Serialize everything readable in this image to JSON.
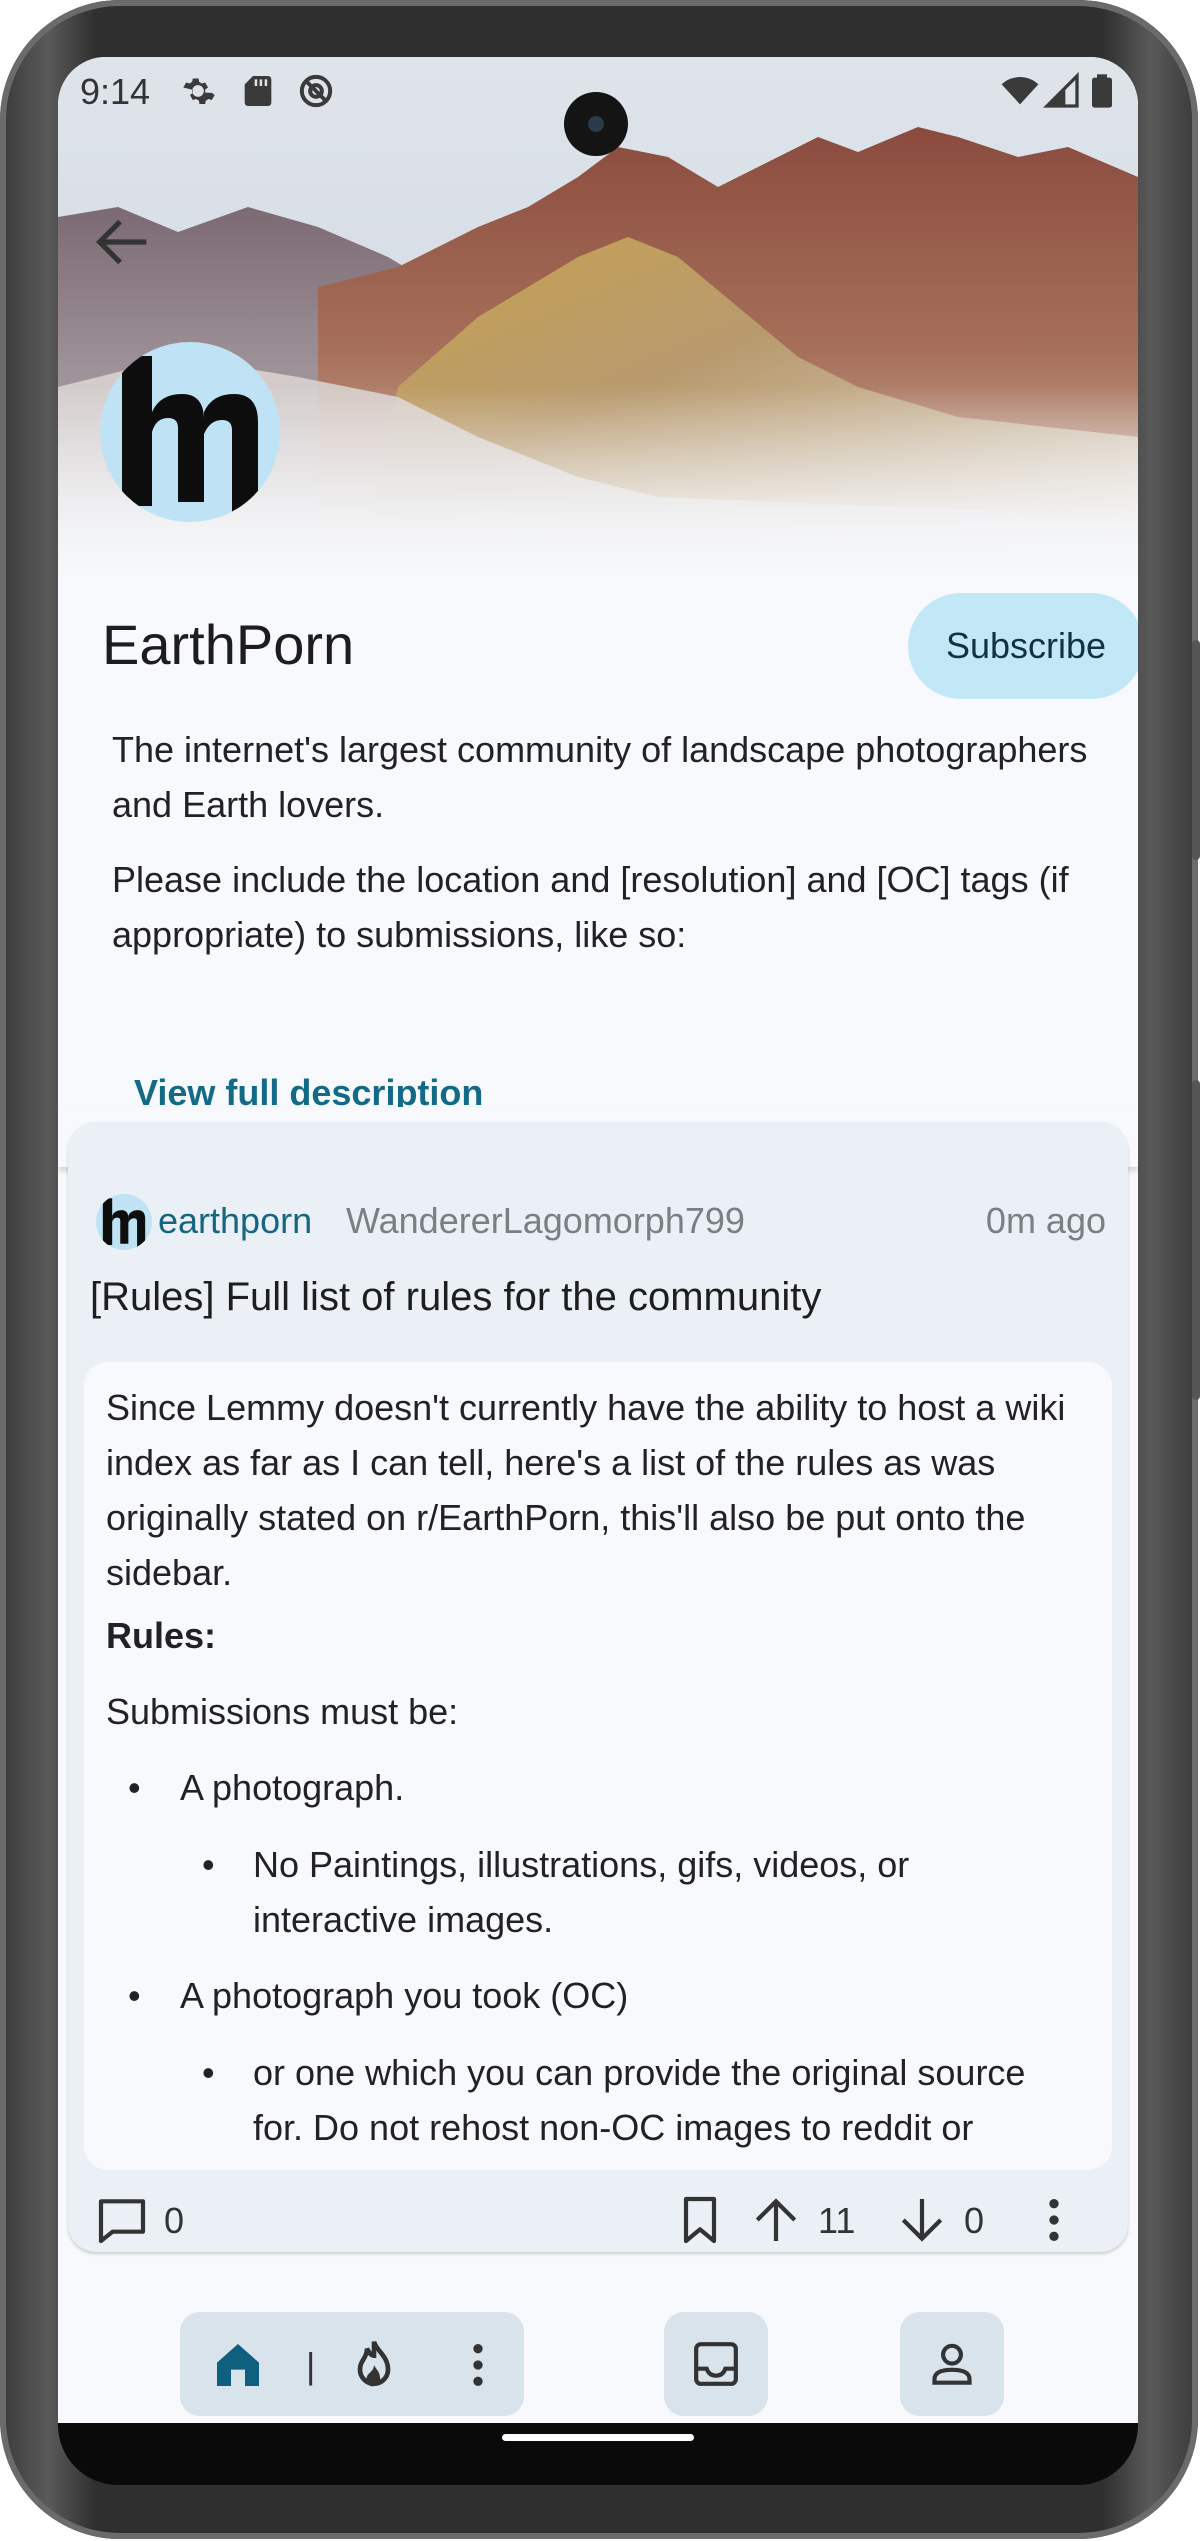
{
  "status_bar": {
    "time": "9:14"
  },
  "community": {
    "name": "EarthPorn",
    "subscribe_label": "Subscribe",
    "description_1": "The internet's largest community of landscape photographers and Earth lovers.",
    "description_2": "Please include the location and [resolution] and [OC] tags (if appropriate) to submissions, like so:",
    "view_full_label": "View full description"
  },
  "post": {
    "community": "earthporn",
    "author": "WandererLagomorph799",
    "time_ago": "0m ago",
    "title": "[Rules] Full list of rules for the community",
    "body": {
      "intro": "Since Lemmy doesn't currently have the ability to host a wiki index as far as I can tell, here's a list of the rules as was originally stated on r/EarthPorn, this'll also be put onto the sidebar.",
      "rules_heading": "Rules:",
      "submissions_line": "Submissions must be:",
      "item_1": "A photograph.",
      "item_1_sub": "No Paintings, illustrations, gifs, videos, or interactive images.",
      "item_2": "A photograph you took (OC)",
      "item_2_sub": "or one which you can provide the original source for. Do not rehost non-OC images to reddit or"
    },
    "comment_count": "0",
    "upvotes": "11",
    "downvotes": "0"
  },
  "icons": {
    "status": [
      "gear-icon",
      "sd-card-icon",
      "data-saver-icon",
      "wifi-icon",
      "signal-icon",
      "battery-icon"
    ],
    "nav": [
      "home-icon",
      "fire-icon",
      "more-icon",
      "inbox-icon",
      "account-icon"
    ]
  },
  "colors": {
    "accent": "#136a87",
    "subscribe_bg": "#c2e8f7",
    "card_bg": "#eaf0f6",
    "surface": "#f7f9fc"
  }
}
